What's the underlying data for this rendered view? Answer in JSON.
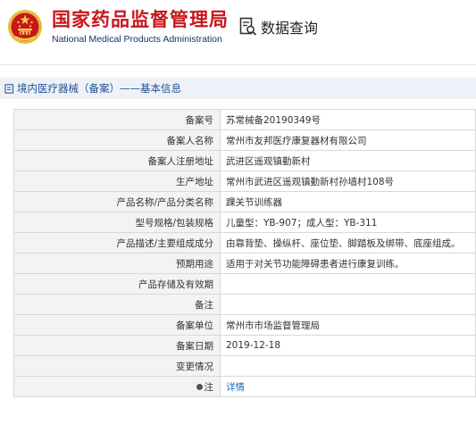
{
  "header": {
    "agency_name_cn": "国家药品监督管理局",
    "agency_name_en": "National Medical Products Administration",
    "query_label": "数据查询",
    "brand_color": "#c8161d",
    "emblem_icon": "national-emblem-icon",
    "query_icon": "data-query-icon"
  },
  "section": {
    "icon": "document-icon",
    "title": "境内医疗器械（备案）——基本信息"
  },
  "rows": [
    {
      "label": "备案号",
      "value": "苏常械备20190349号"
    },
    {
      "label": "备案人名称",
      "value": "常州市友邦医疗康复器材有限公司"
    },
    {
      "label": "备案人注册地址",
      "value": "武进区遥观镇勤新村"
    },
    {
      "label": "生产地址",
      "value": "常州市武进区遥观镇勤新村孙墙村108号"
    },
    {
      "label": "产品名称/产品分类名称",
      "value": "踝关节训练器"
    },
    {
      "label": "型号规格/包装规格",
      "value": "儿童型：YB-907；成人型：YB-311"
    },
    {
      "label": "产品描述/主要组成成分",
      "value": "由靠背垫、操纵杆、座位垫、脚踏板及绑带、底座组成。"
    },
    {
      "label": "预期用途",
      "value": "适用于对关节功能障碍患者进行康复训练。"
    },
    {
      "label": "产品存储及有效期",
      "value": ""
    },
    {
      "label": "备注",
      "value": ""
    },
    {
      "label": "备案单位",
      "value": "常州市市场监督管理局"
    },
    {
      "label": "备案日期",
      "value": "2019-12-18"
    },
    {
      "label": "变更情况",
      "value": ""
    }
  ],
  "note_row": {
    "label": "注",
    "icon": "note-bullet-icon",
    "link_text": "详情"
  }
}
